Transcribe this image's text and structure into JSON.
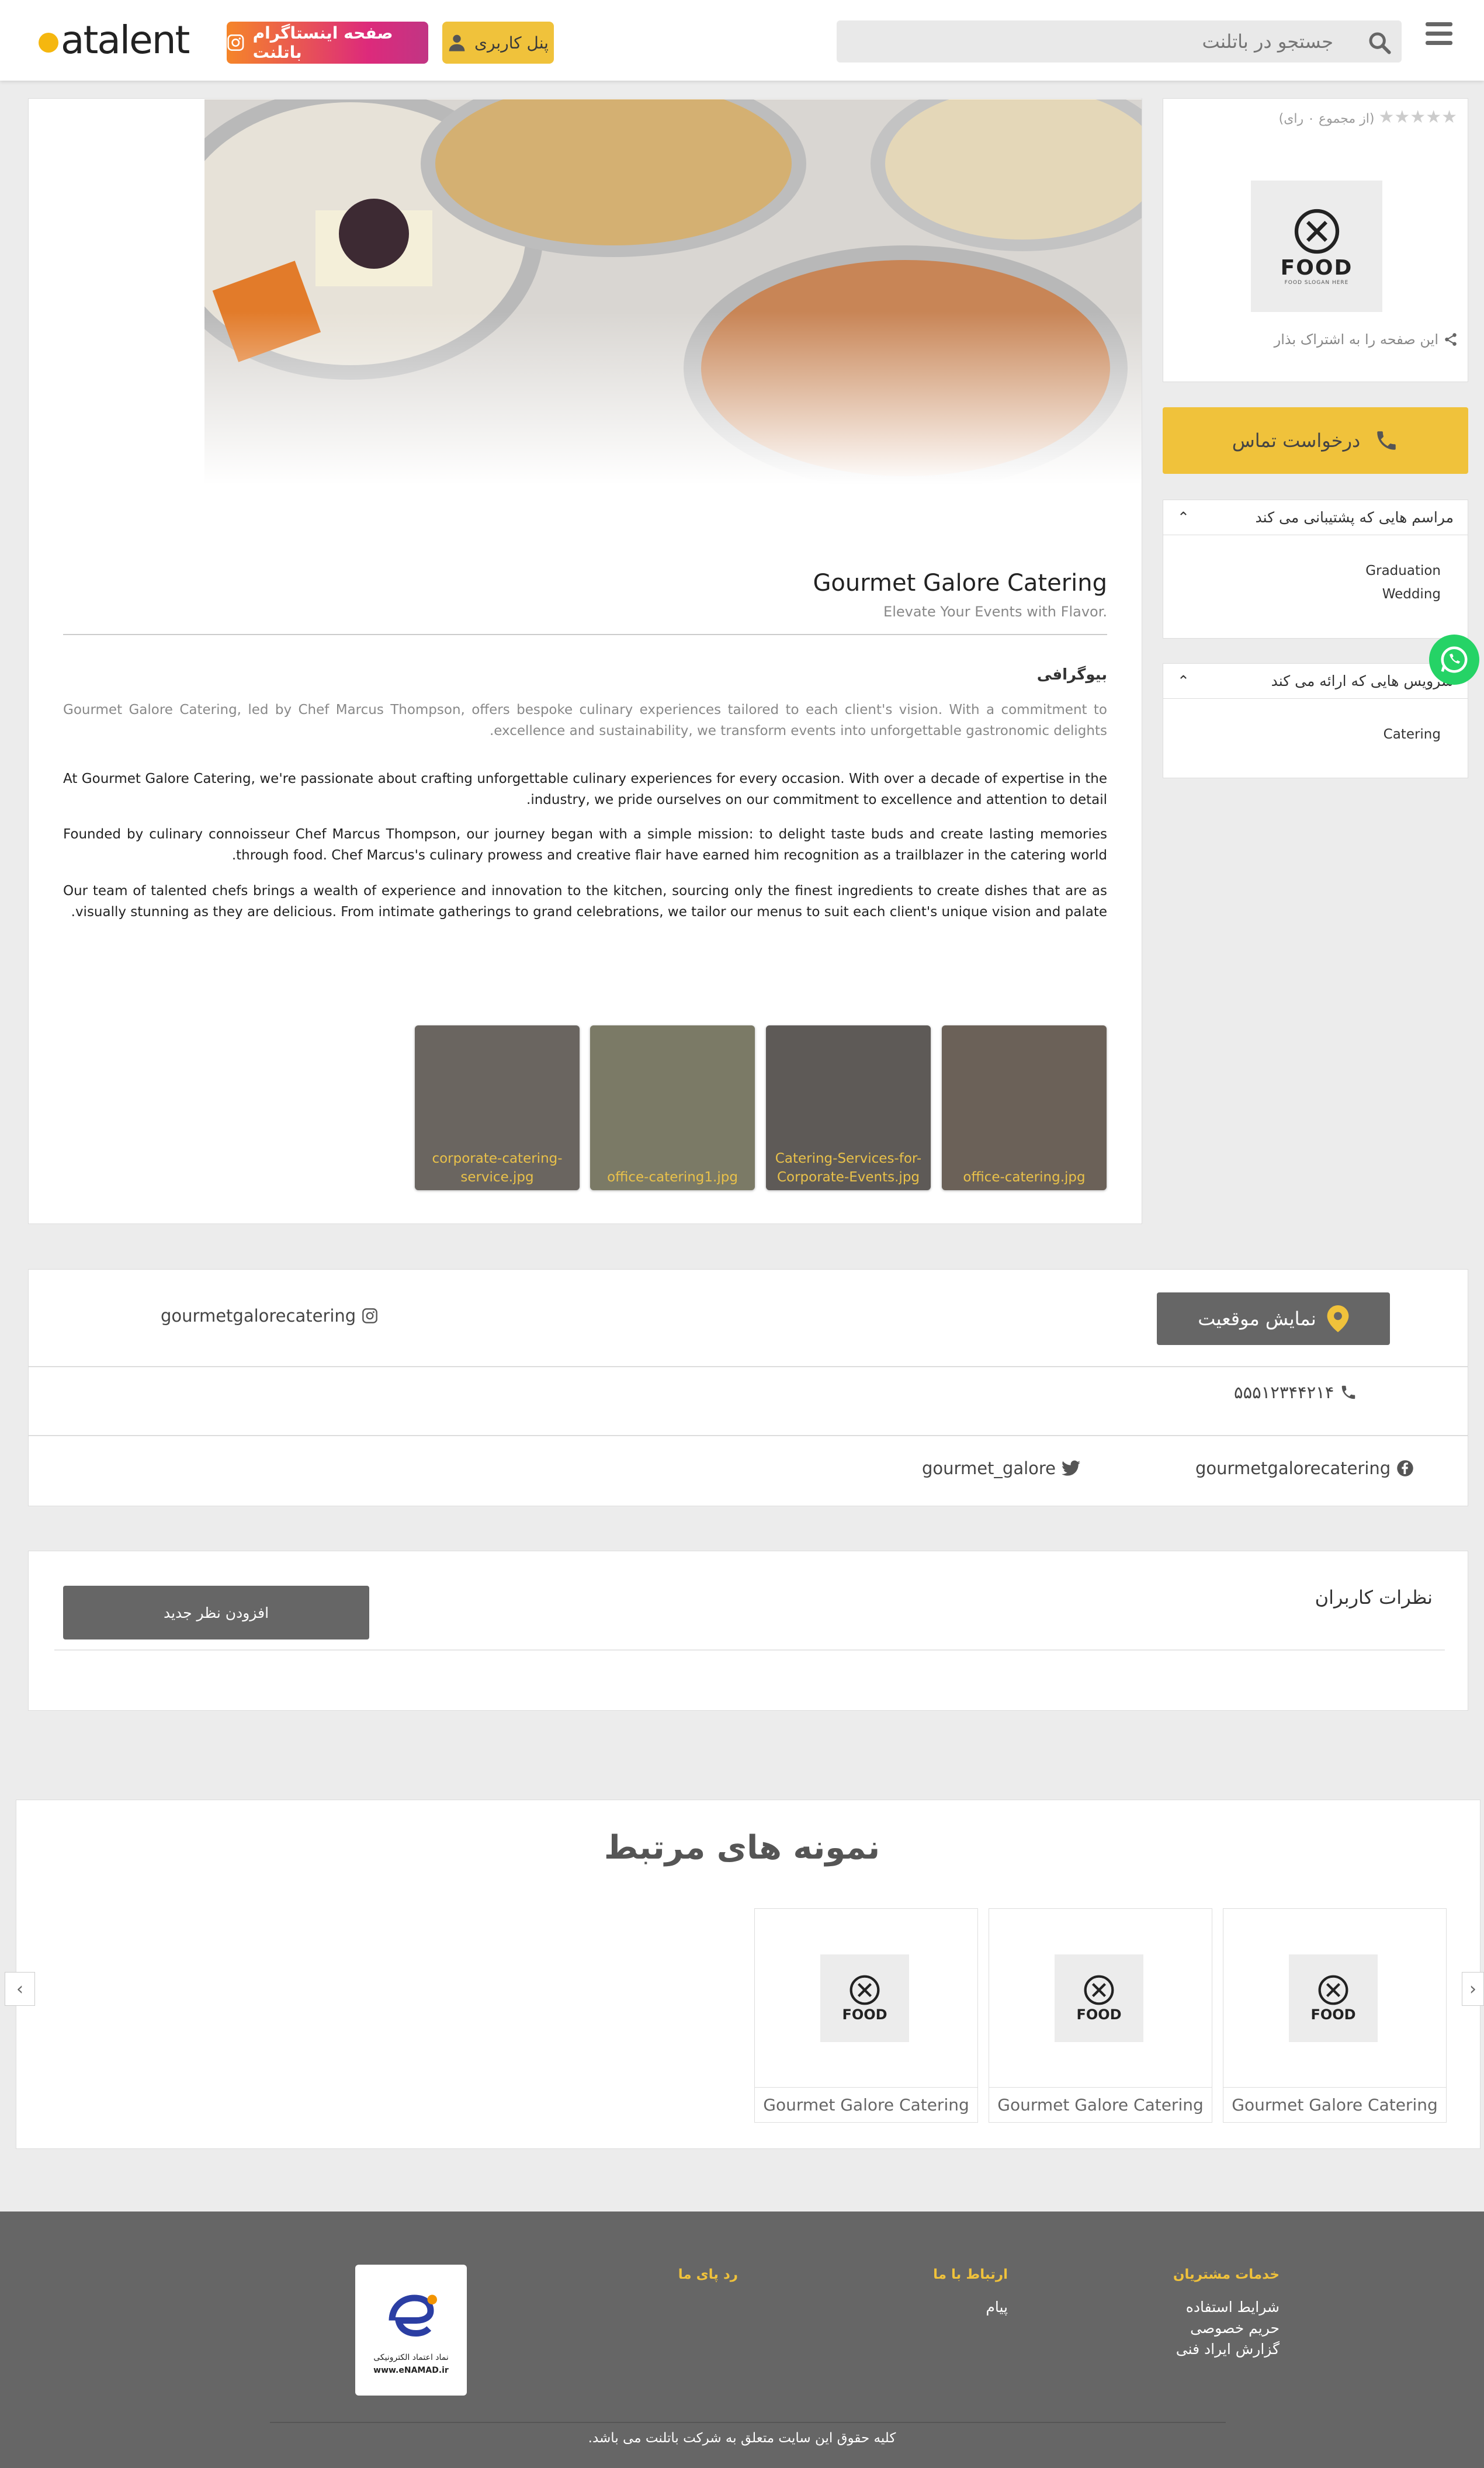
{
  "header": {
    "logo_text": "atalent",
    "instagram_button": "صفحه اینستاگرام باتلنت",
    "panel_button": "پنل کاربری",
    "search_placeholder": "جستجو در باتلنت"
  },
  "profile": {
    "business_name": "Gourmet Galore Catering",
    "slogan": "Elevate Your Events with Flavor.",
    "bio_heading": "بیوگرافی",
    "bio_paragraphs": [
      "Gourmet Galore Catering, led by Chef Marcus Thompson, offers bespoke culinary experiences tailored to each client's vision. With a commitment to excellence and sustainability, we transform events into unforgettable gastronomic delights.",
      "At Gourmet Galore Catering, we're passionate about crafting unforgettable culinary experiences for every occasion. With over a decade of expertise in the industry, we pride ourselves on our commitment to excellence and attention to detail.",
      "Founded by culinary connoisseur Chef Marcus Thompson, our journey began with a simple mission: to delight taste buds and create lasting memories through food. Chef Marcus's culinary prowess and creative flair have earned him recognition as a trailblazer in the catering world.",
      "Our team of talented chefs brings a wealth of experience and innovation to the kitchen, sourcing only the finest ingredients to create dishes that are as visually stunning as they are delicious. From intimate gatherings to grand celebrations, we tailor our menus to suit each client's unique vision and palate."
    ],
    "gallery": [
      {
        "caption": "office-catering.jpg",
        "color": "#6b6158"
      },
      {
        "caption": "Catering-Services-for-Corporate-Events.jpg",
        "color": "#5e5a57"
      },
      {
        "caption": "office-catering1.jpg",
        "color": "#7b7a66"
      },
      {
        "caption": "corporate-catering-service.jpg",
        "color": "#6a6560"
      }
    ]
  },
  "sidebar": {
    "rating_text": "(از مجموع ۰ رای)",
    "rating_stars": 0,
    "logo_word": "FOOD",
    "logo_sub": "FOOD SLOGAN HERE",
    "share_text": "این صفحه را به اشتراک بذار",
    "call_button": "درخواست تماس",
    "events_title": "مراسم هایی که پشتیبانی می کند",
    "events": [
      "Graduation",
      "Wedding"
    ],
    "services_title": "سرویس هایی که ارائه می کند",
    "services": [
      "Catering"
    ]
  },
  "contact": {
    "location_button": "نمایش موقعیت",
    "instagram": "gourmetgalorecatering",
    "phone": "۵۵۵۱۲۳۴۴۲۱۴",
    "facebook": "gourmetgalorecatering",
    "twitter": "gourmet_galore"
  },
  "comments": {
    "title": "نظرات کاربران",
    "add_button": "افزودن نظر جدید"
  },
  "related": {
    "title": "نمونه های مرتبط",
    "items": [
      {
        "name": "Gourmet Galore Catering"
      },
      {
        "name": "Gourmet Galore Catering"
      },
      {
        "name": "Gourmet Galore Catering"
      }
    ]
  },
  "footer": {
    "col1_title": "خدمات مشتریان",
    "col1_links": [
      "شرایط استفاده",
      "حریم خصوصی",
      "گزارش ایراد فنی"
    ],
    "col2_title": "ارتباط با ما",
    "col2_links": [
      "پیام"
    ],
    "col3_title": "رد پای ما",
    "enamad_text": "نماد اعتماد الکترونیکی",
    "enamad_url": "www.eNAMAD.ir",
    "copyright": "کلیه حقوق این سایت متعلق به شرکت باتلنت می باشد."
  },
  "colors": {
    "accent_yellow": "#f0c23b",
    "button_gray": "#666666",
    "whatsapp": "#25d366"
  }
}
